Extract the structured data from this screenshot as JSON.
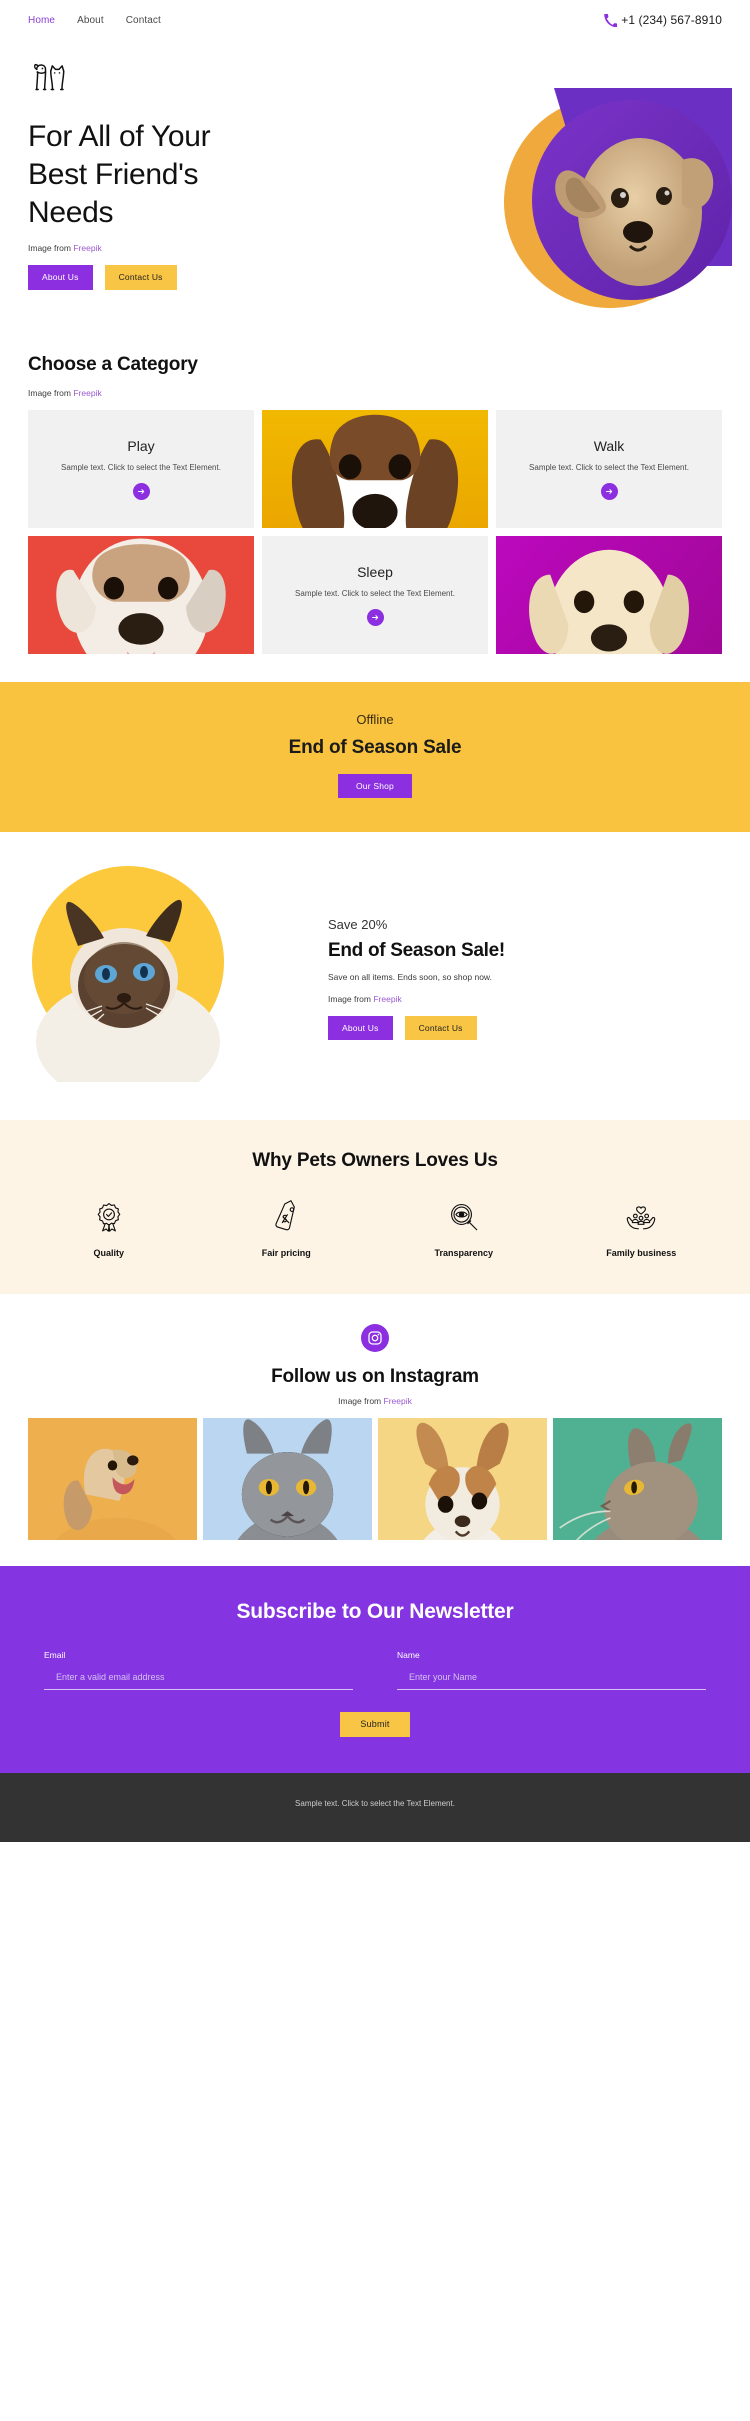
{
  "header": {
    "nav": [
      {
        "label": "Home",
        "active": true
      },
      {
        "label": "About",
        "active": false
      },
      {
        "label": "Contact",
        "active": false
      }
    ],
    "phone": "+1 (234) 567-8910",
    "phone_icon": "phone-icon"
  },
  "hero": {
    "logo_icon": "dog-cat-logo-icon",
    "title": "For All of Your Best Friend's Needs",
    "credit_prefix": "Image from ",
    "credit_link": "Freepik",
    "buttons": [
      {
        "label": "About Us",
        "style": "purple"
      },
      {
        "label": "Contact Us",
        "style": "yellow"
      }
    ],
    "image_alt": "french-bulldog-photo"
  },
  "category": {
    "title": "Choose a Category",
    "credit_prefix": "Image from ",
    "credit_link": "Freepik",
    "cells": [
      {
        "type": "text",
        "name": "Play",
        "desc": "Sample text. Click to select the Text Element.",
        "arrow": "arrow-right-icon"
      },
      {
        "type": "photo",
        "alt": "beagle-puppy-photo",
        "bg": "#F0B400"
      },
      {
        "type": "text",
        "name": "Walk",
        "desc": "Sample text. Click to select the Text Element.",
        "arrow": "arrow-right-icon"
      },
      {
        "type": "photo",
        "alt": "bulldog-photo",
        "bg": "#E8493C"
      },
      {
        "type": "text",
        "name": "Sleep",
        "desc": "Sample text. Click to select the Text Element.",
        "arrow": "arrow-right-icon"
      },
      {
        "type": "photo",
        "alt": "golden-retriever-puppy-photo",
        "bg": "#BC09B8"
      }
    ]
  },
  "sale_banner": {
    "kicker": "Offline",
    "title": "End of Season Sale",
    "button": "Our Shop",
    "bg": "#F9C33F"
  },
  "promo": {
    "kicker": "Save 20%",
    "title": "End of Season Sale!",
    "desc": "Save on all items. Ends soon, so shop now.",
    "credit_prefix": "Image from ",
    "credit_link": "Freepik",
    "buttons": [
      {
        "label": "About Us",
        "style": "purple"
      },
      {
        "label": "Contact Us",
        "style": "yellow"
      }
    ],
    "image_alt": "siamese-cat-photo"
  },
  "why": {
    "title": "Why Pets Owners Loves Us",
    "bg": "#FDF4E6",
    "items": [
      {
        "label": "Quality",
        "icon": "award-ribbon-icon"
      },
      {
        "label": "Fair pricing",
        "icon": "price-tag-dollar-icon"
      },
      {
        "label": "Transparency",
        "icon": "magnifier-eye-icon"
      },
      {
        "label": "Family business",
        "icon": "hands-holding-family-icon"
      }
    ]
  },
  "instagram": {
    "badge_icon": "instagram-icon",
    "title": "Follow us on Instagram",
    "credit_prefix": "Image from ",
    "credit_link": "Freepik",
    "photos": [
      {
        "alt": "beagle-on-orange-photo",
        "bg": "#EEAF4E"
      },
      {
        "alt": "grey-cat-on-blue-photo",
        "bg": "#BBD6F0"
      },
      {
        "alt": "chihuahua-on-yellow-photo",
        "bg": "#F4D684"
      },
      {
        "alt": "cat-on-green-photo",
        "bg": "#4FB192"
      }
    ]
  },
  "newsletter": {
    "title": "Subscribe to Our Newsletter",
    "bg": "#8434E0",
    "email_label": "Email",
    "email_placeholder": "Enter a valid email address",
    "email_value": "",
    "name_label": "Name",
    "name_placeholder": "Enter your Name",
    "name_value": "",
    "submit_label": "Submit"
  },
  "footer": {
    "text": "Sample text. Click to select the Text Element.",
    "bg": "#333333"
  },
  "colors": {
    "purple": "#8B2FE0",
    "yellow": "#F9C33F",
    "orange": "#F0A93C",
    "cream": "#FDF4E6",
    "dark": "#333333"
  }
}
